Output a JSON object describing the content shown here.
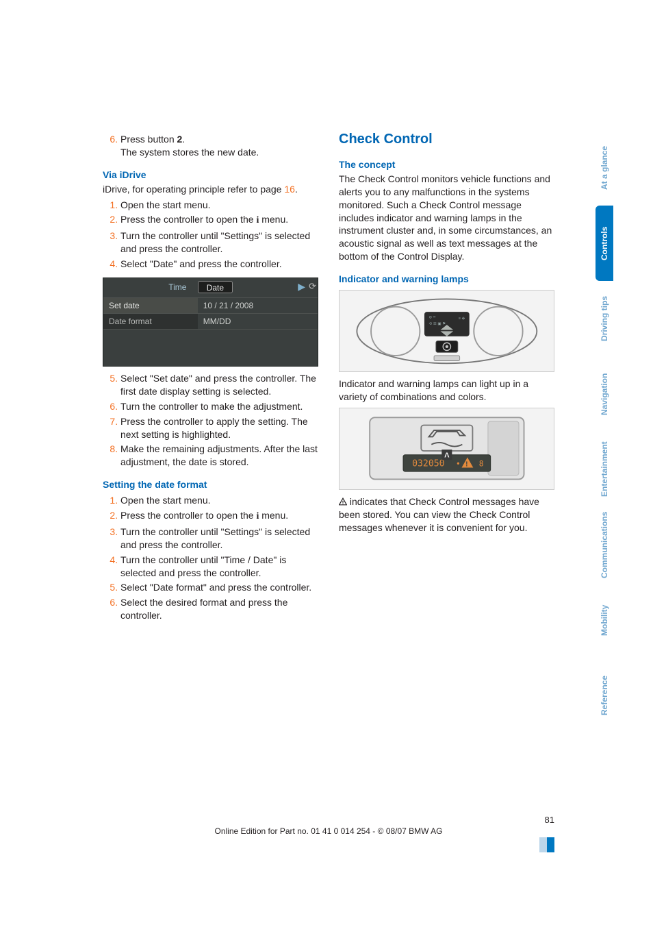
{
  "left": {
    "step6_a": "Press button ",
    "step6_bold": "2",
    "step6_b": ".",
    "step6_line2": "The system stores the new date.",
    "via_idrive_heading": "Via iDrive",
    "idrive_intro_a": "iDrive, for operating principle refer to page ",
    "idrive_intro_page": "16",
    "idrive_intro_b": ".",
    "steps_a": {
      "s1": "Open the start menu.",
      "s2_a": "Press the controller to open the ",
      "s2_b": " menu.",
      "s3": "Turn the controller until \"Settings\" is selected and press the controller.",
      "s4": "Select \"Date\" and press the controller."
    },
    "screenshot": {
      "tab_time": "Time",
      "tab_date": "Date",
      "row1_l": "Set date",
      "row1_r": "10 / 21 / 2008",
      "row2_l": "Date format",
      "row2_r": "MM/DD"
    },
    "steps_b": {
      "s5": "Select \"Set date\" and press the controller. The first date display setting is selected.",
      "s6": "Turn the controller to make the adjustment.",
      "s7": "Press the controller to apply the setting. The next setting is highlighted.",
      "s8": "Make the remaining adjustments. After the last adjustment, the date is stored."
    },
    "date_format_heading": "Setting the date format",
    "steps_c": {
      "s1": "Open the start menu.",
      "s2_a": "Press the controller to open the ",
      "s2_b": " menu.",
      "s3": "Turn the controller until \"Settings\" is selected and press the controller.",
      "s4": "Turn the controller until \"Time / Date\" is selected and press the controller.",
      "s5": "Select \"Date format\" and press the controller.",
      "s6": "Select the desired format and press the controller."
    }
  },
  "right": {
    "section_heading": "Check Control",
    "concept_heading": "The concept",
    "concept_body": "The Check Control monitors vehicle functions and alerts you to any malfunctions in the systems monitored. Such a Check Control message includes indicator and warning lamps in the instrument cluster and, in some circumstances, an acoustic signal as well as text messages at the bottom of the Control Display.",
    "lamps_heading": "Indicator and warning lamps",
    "lamps_body": "Indicator and warning lamps can light up in a variety of combinations and colors.",
    "lcd_label_a": "A",
    "lcd_text": "032050",
    "warn_body": " indicates that Check Control messages have been stored. You can view the Check Control messages whenever it is convenient for you."
  },
  "sidebar": {
    "t1": "At a glance",
    "t2": "Controls",
    "t3": "Driving tips",
    "t4": "Navigation",
    "t5": "Entertainment",
    "t6": "Communications",
    "t7": "Mobility",
    "t8": "Reference"
  },
  "footer": {
    "page": "81",
    "line": "Online Edition for Part no. 01 41 0 014 254 - © 08/07 BMW AG"
  }
}
